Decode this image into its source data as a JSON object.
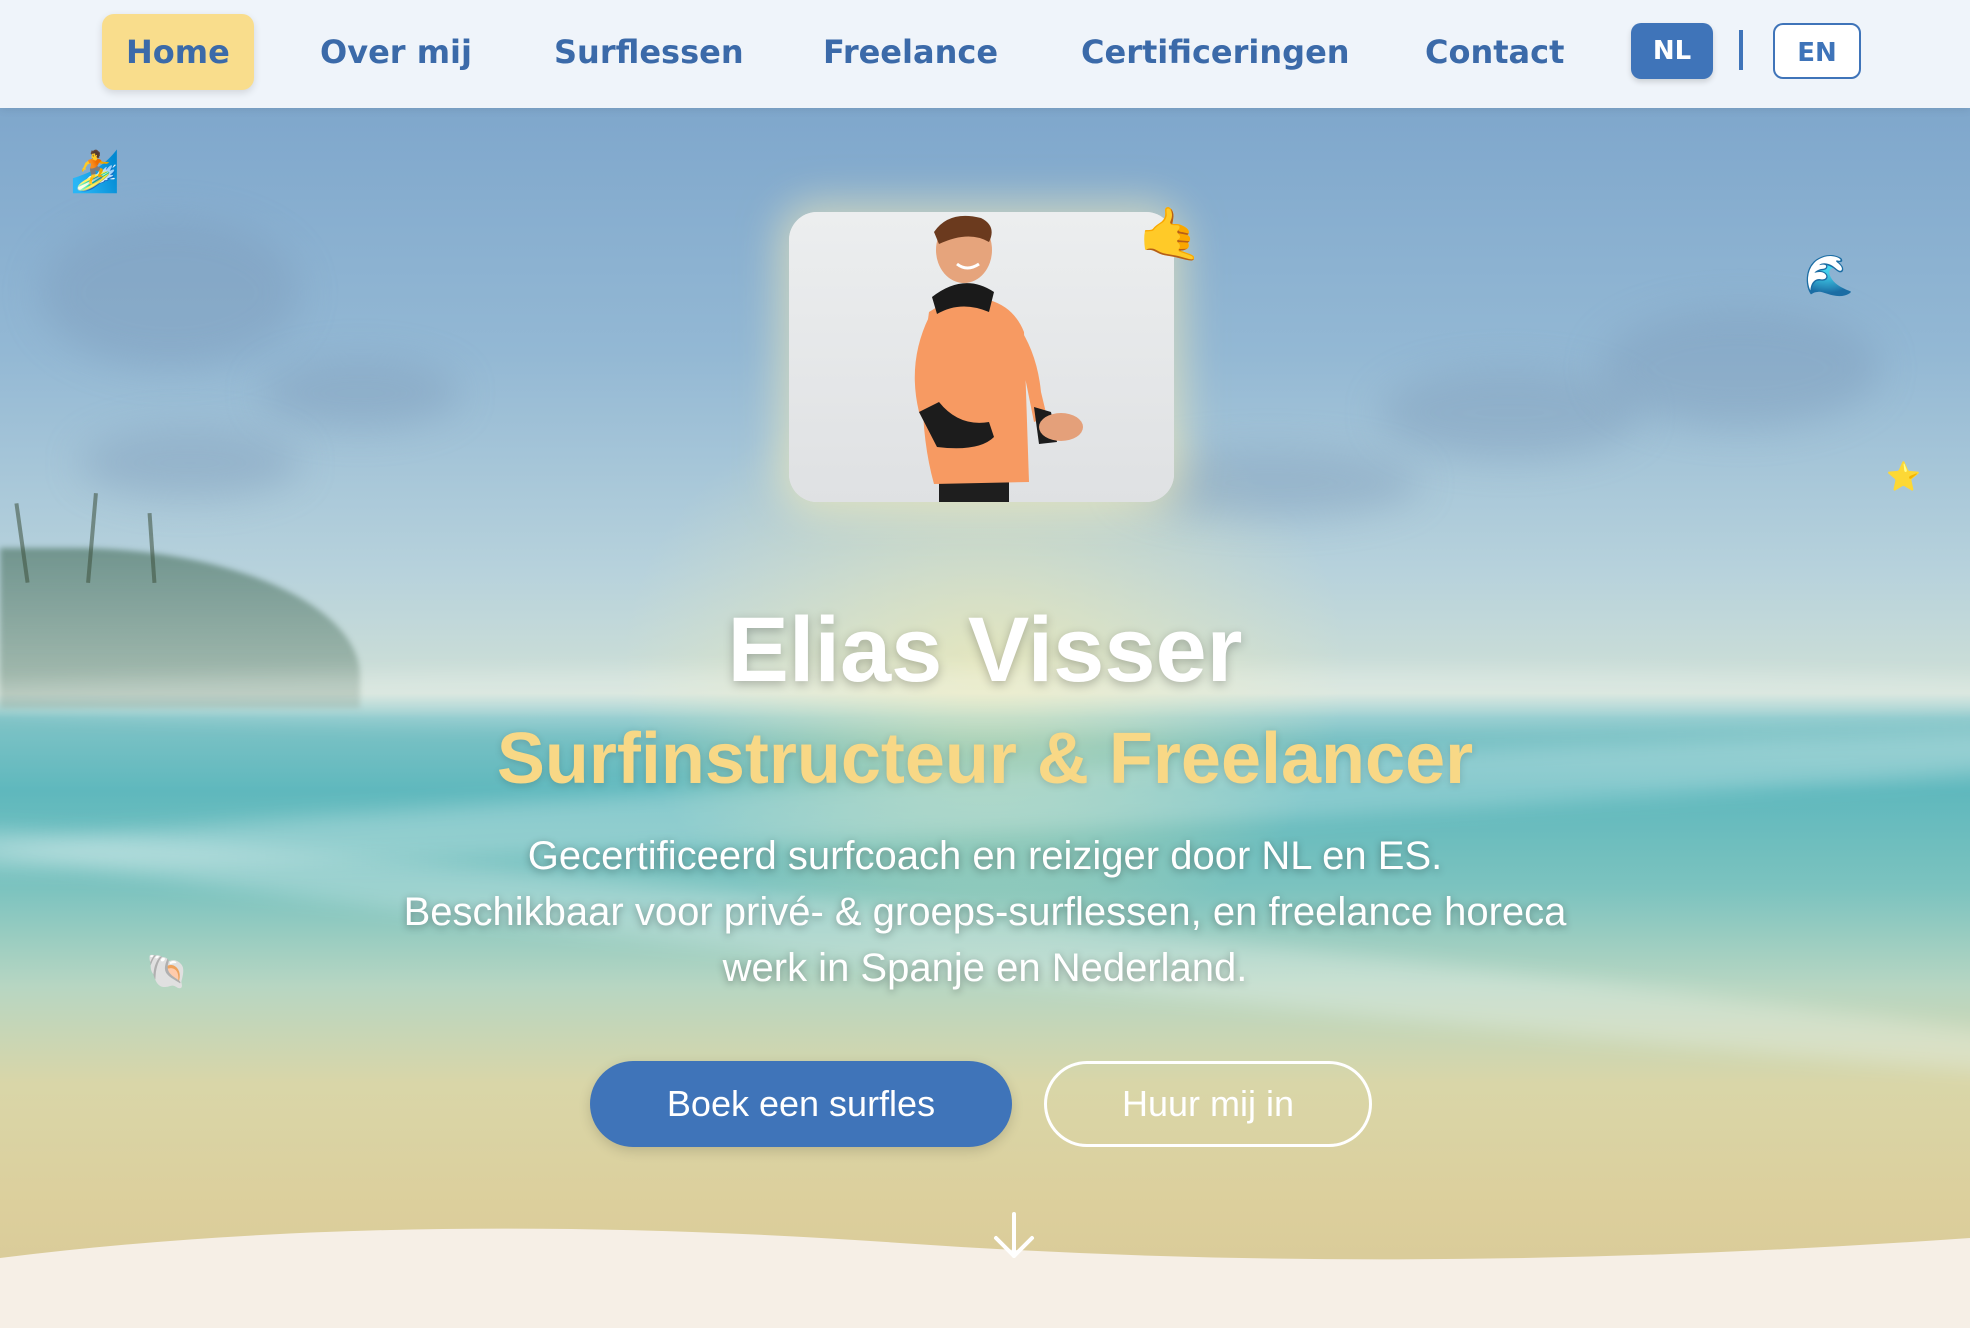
{
  "nav": {
    "items": [
      {
        "label": "Home",
        "active": true
      },
      {
        "label": "Over mij"
      },
      {
        "label": "Surflessen"
      },
      {
        "label": "Freelance"
      },
      {
        "label": "Certificeringen"
      },
      {
        "label": "Contact"
      }
    ],
    "lang_nl": "NL",
    "lang_en": "EN",
    "active_lang": "NL"
  },
  "hero": {
    "name": "Elias Visser",
    "subtitle": "Surfinstructeur & Freelancer",
    "desc_line1": "Gecertificeerd surfcoach en reiziger door NL en ES.",
    "desc_line2": "Beschikbaar voor privé- & groeps-surflessen, en freelance horeca",
    "desc_line3": "werk in Spanje en Nederland.",
    "cta_primary": "Boek een surfles",
    "cta_secondary": "Huur mij in",
    "decorations": {
      "surfer": "🏄",
      "wave": "🌊",
      "shaka": "🤙",
      "star": "⭐",
      "shell": "🐚"
    }
  },
  "colors": {
    "primary": "#3f74b9",
    "accent_yellow": "#f9dd8c",
    "subtitle_yellow": "#f8d886",
    "nav_bg": "#eff4fa",
    "sand": "#f6efe6"
  },
  "icons": {
    "scroll_down": "arrow-down-icon"
  }
}
